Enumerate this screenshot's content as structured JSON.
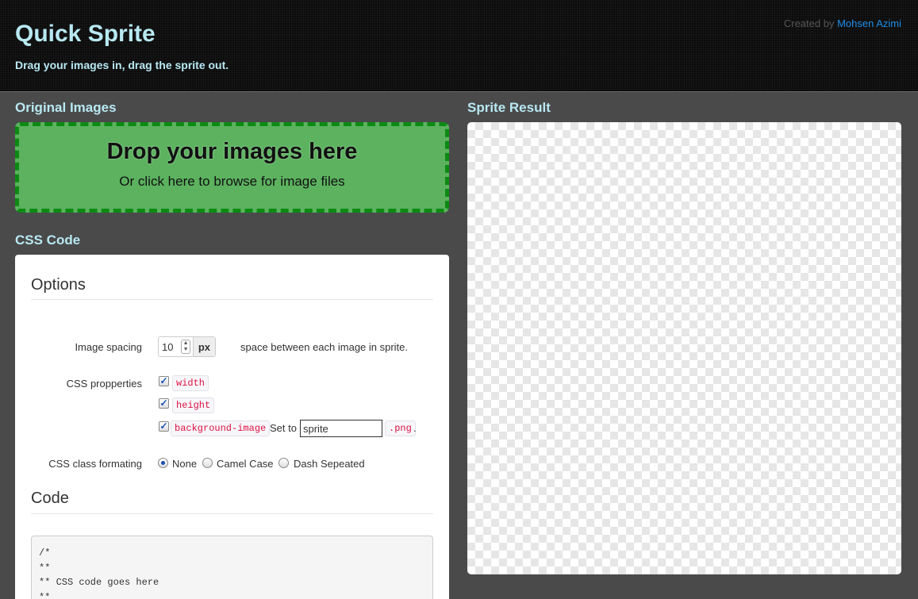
{
  "header": {
    "title": "Quick Sprite",
    "subtitle": "Drag your images in, drag the sprite out.",
    "credit_prefix": "Created by",
    "credit_author": "Mohsen Azimi"
  },
  "left": {
    "original_title": "Original Images",
    "drop_title": "Drop your images here",
    "drop_sub": "Or click here to browse for image files",
    "css_title": "CSS Code"
  },
  "options": {
    "heading": "Options",
    "spacing_label": "Image spacing",
    "spacing_value": "10",
    "spacing_unit": "px",
    "spacing_hint": "space between each image in sprite.",
    "props_label": "CSS propperties",
    "props": [
      {
        "name": "width",
        "checked": true
      },
      {
        "name": "height",
        "checked": true
      },
      {
        "name": "background-image",
        "checked": true
      }
    ],
    "set_to": "Set to",
    "filename_value": "sprite",
    "ext": ".png",
    "ext_dot": ".",
    "class_label": "CSS class formating",
    "class_options": [
      {
        "label": "None",
        "selected": true
      },
      {
        "label": "Camel Case",
        "selected": false
      },
      {
        "label": "Dash Sepeated",
        "selected": false
      }
    ]
  },
  "code": {
    "heading": "Code",
    "content": "/*\n**\n** CSS code goes here\n**"
  },
  "right": {
    "sprite_title": "Sprite Result"
  },
  "colors": {
    "accent_title": "#b8e8f2",
    "drop_green": "#5cb25f",
    "drop_border": "#0d8a14",
    "link": "#1f8ce6"
  }
}
